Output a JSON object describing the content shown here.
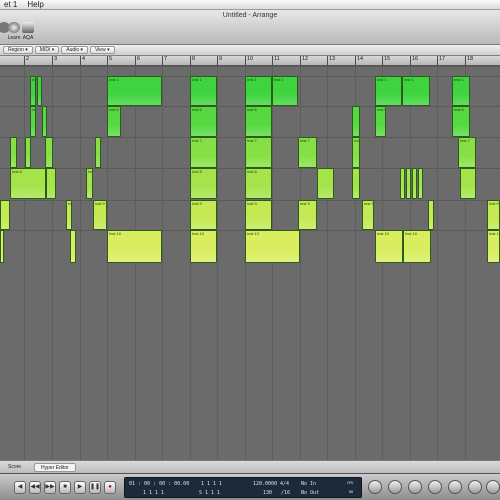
{
  "menubar": {
    "items": [
      "et 1",
      "Help"
    ]
  },
  "window": {
    "title": "Untitled - Arrange"
  },
  "toolbar": {
    "tools": [
      {
        "label": "Learn"
      },
      {
        "label": "AQA"
      }
    ]
  },
  "local_menu": [
    "Region",
    "MIDI",
    "Audio",
    "View"
  ],
  "ruler": {
    "bars": [
      "2",
      "3",
      "4",
      "5",
      "6",
      "7",
      "8",
      "9",
      "10",
      "11",
      "12",
      "13",
      "14",
      "15",
      "16",
      "17",
      "18"
    ]
  },
  "tracks": [
    "Inst 1",
    "Inst 6",
    "Inst 7",
    "Inst 8",
    "Inst 9",
    "Inst 10"
  ],
  "colors": {
    "row0": "#3fd43f",
    "row1": "#55d840",
    "row2": "#86df44",
    "row3": "#a5e34a",
    "row4": "#c4e953",
    "row5": "#d8ee5e"
  },
  "tabs": [
    "Score",
    "Hyper Editor"
  ],
  "transport": {
    "buttons": [
      "rewind",
      "fast-forward",
      "stop",
      "play",
      "pause",
      "record"
    ],
    "smpte": "01 : 00 : 00 : 00.00",
    "bars_top": "1   1   1   1",
    "bars_bottom": "1   1   1   1",
    "pos2_top": "1   1   1   1",
    "pos2_bottom": "S  1   1   1",
    "tempo": "120.0000",
    "tempo_sub": "130",
    "signature": "4/4",
    "division": "/16",
    "in": "No In",
    "out": "No Out",
    "cpu": "CPU",
    "hd": "HD"
  }
}
